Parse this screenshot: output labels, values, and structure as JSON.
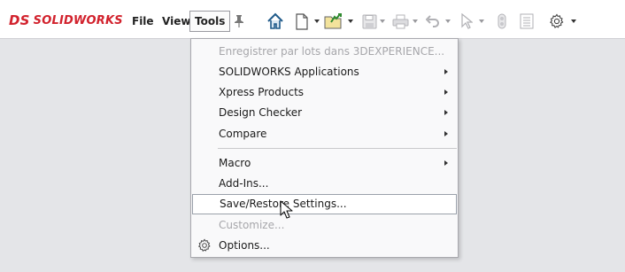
{
  "app": {
    "logo_text": "SOLIDWORKS",
    "logo_prefix": "DS"
  },
  "menubar": [
    {
      "label": "File"
    },
    {
      "label": "View"
    },
    {
      "label": "Tools"
    }
  ],
  "toolbar": {
    "icons": [
      "pin-icon",
      "home-icon",
      "new-document-icon",
      "open-folder-icon",
      "save-icon",
      "print-icon",
      "undo-icon",
      "select-icon",
      "rebuild-icon",
      "file-properties-icon",
      "options-gear-icon"
    ]
  },
  "tools_menu": {
    "items": [
      {
        "label": "Enregistrer par lots dans 3DEXPERIENCE...",
        "disabled": true,
        "submenu": false
      },
      {
        "label": "SOLIDWORKS Applications",
        "disabled": false,
        "submenu": true
      },
      {
        "label": "Xpress Products",
        "disabled": false,
        "submenu": true
      },
      {
        "label": "Design Checker",
        "disabled": false,
        "submenu": true
      },
      {
        "label": "Compare",
        "disabled": false,
        "submenu": true
      },
      {
        "label": "Macro",
        "disabled": false,
        "submenu": true
      },
      {
        "label": "Add-Ins...",
        "disabled": false,
        "submenu": false
      },
      {
        "label": "Save/Restore Settings...",
        "disabled": false,
        "submenu": false,
        "highlighted": true
      },
      {
        "label": "Customize...",
        "disabled": true,
        "submenu": false
      },
      {
        "label": "Options...",
        "disabled": false,
        "submenu": false,
        "icon": "gear-icon"
      }
    ]
  },
  "colors": {
    "brand_red": "#d2222d",
    "background": "#e4e5e8",
    "menu_bg": "#f9f9fa"
  }
}
